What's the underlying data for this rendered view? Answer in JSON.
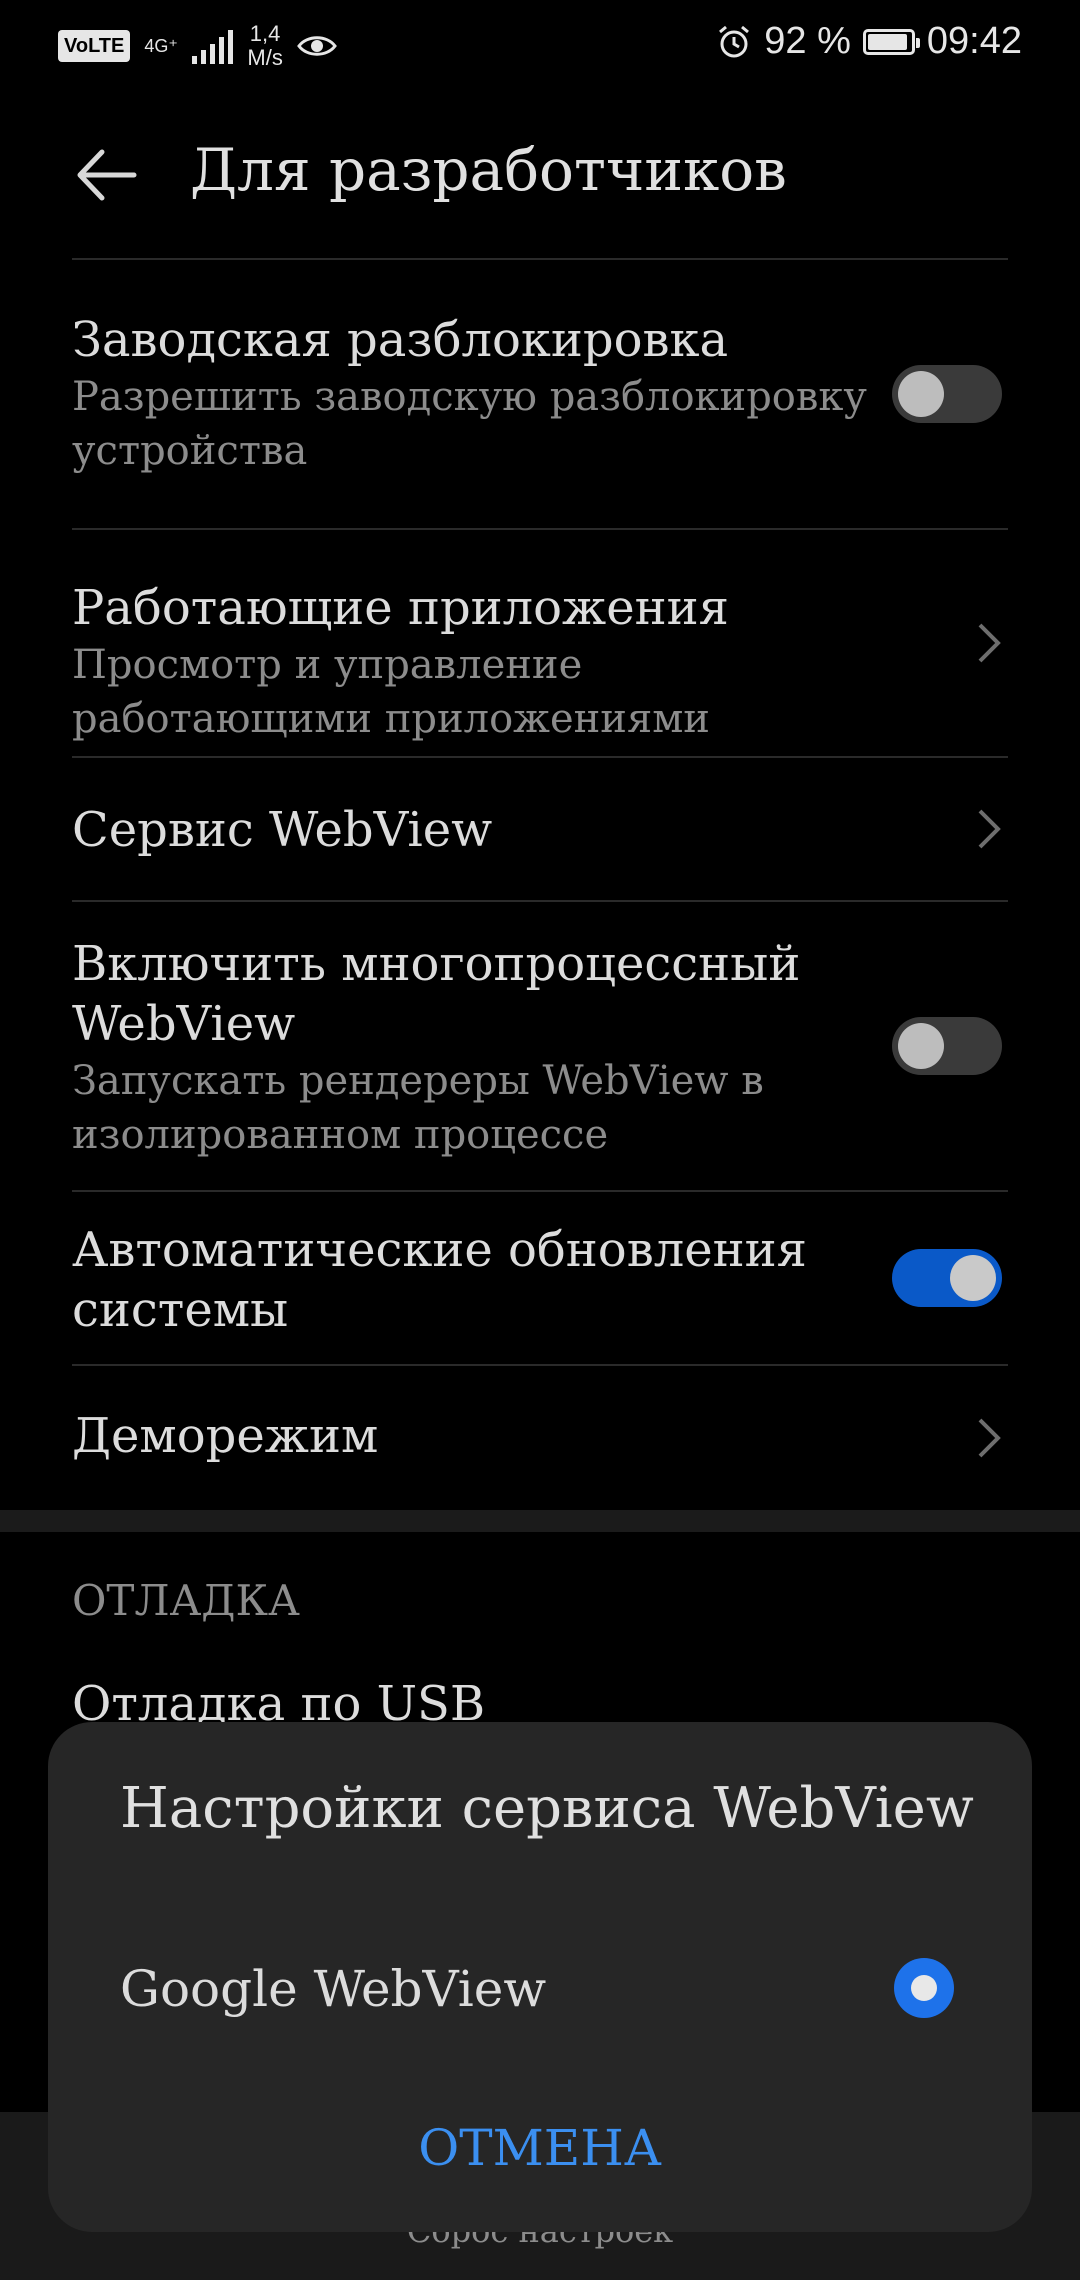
{
  "status_bar": {
    "volte": "VoLTE",
    "network": "4G⁺",
    "speed_value": "1,4",
    "speed_unit": "M/s",
    "battery_percent": "92 %",
    "battery_level": 0.92,
    "time": "09:42"
  },
  "header": {
    "title": "Для разработчиков"
  },
  "settings": {
    "items": [
      {
        "title": "Заводская разблокировка",
        "subtitle": "Разрешить заводскую разблокировку устройства",
        "control": "toggle",
        "on": false
      },
      {
        "title": "Работающие приложения",
        "subtitle": "Просмотр и управление работающими приложениями",
        "control": "chevron"
      },
      {
        "title": "Сервис WebView",
        "subtitle": "",
        "control": "chevron"
      },
      {
        "title": "Включить многопроцессный WebView",
        "subtitle": "Запускать рендереры WebView в изолированном процессе",
        "control": "toggle",
        "on": false
      },
      {
        "title": "Автоматические обновления системы",
        "subtitle": "",
        "control": "toggle",
        "on": true
      },
      {
        "title": "Деморежим",
        "subtitle": "",
        "control": "chevron"
      }
    ]
  },
  "debug_section": {
    "header": "ОТЛАДКА",
    "usb_item": "Отладка по USB"
  },
  "bottom_bar": {
    "reset_label": "Сброс настроек"
  },
  "dialog": {
    "title": "Настройки сервиса WebView",
    "option_label": "Google WebView",
    "option_selected": true,
    "cancel_label": "ОТМЕНА"
  },
  "colors": {
    "accent": "#1e72ea",
    "toggle_on": "#0a59c8",
    "cancel_text": "#3b8ff0",
    "background": "#000000",
    "dialog_bg": "#262626"
  },
  "icons": {
    "back": "arrow-left-icon",
    "chevron": "chevron-right-icon",
    "alarm": "alarm-icon",
    "eye": "eye-icon",
    "battery": "battery-icon",
    "signal": "signal-icon"
  }
}
